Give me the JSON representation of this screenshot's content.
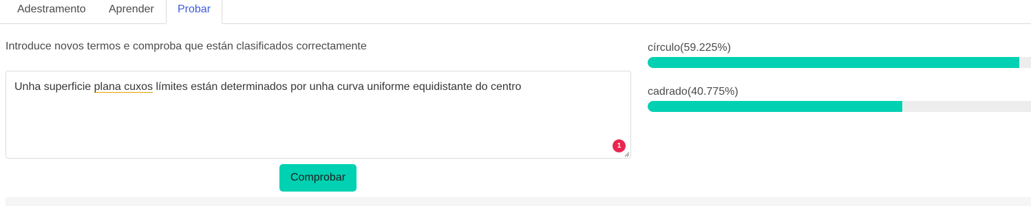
{
  "tabs": [
    {
      "label": "Adestramento",
      "active": false
    },
    {
      "label": "Aprender",
      "active": false
    },
    {
      "label": "Probar",
      "active": true
    }
  ],
  "instructions": "Introduce novos termos e comproba que están clasificados correctamente",
  "input": {
    "text_before": "Unha superficie ",
    "text_flagged": "plana cuxos",
    "text_after": " límites están determinados por unha curva uniforme equidistante do centro",
    "issue_count": "1"
  },
  "submit_label": "Comprobar",
  "results": [
    {
      "label": "círculo(59.225%)",
      "value": 0.97
    },
    {
      "label": "cadrado(40.775%)",
      "value": 0.665
    }
  ],
  "colors": {
    "accent": "#00d1b2",
    "active_tab": "#3e5bd8",
    "badge": "#e8264f"
  }
}
